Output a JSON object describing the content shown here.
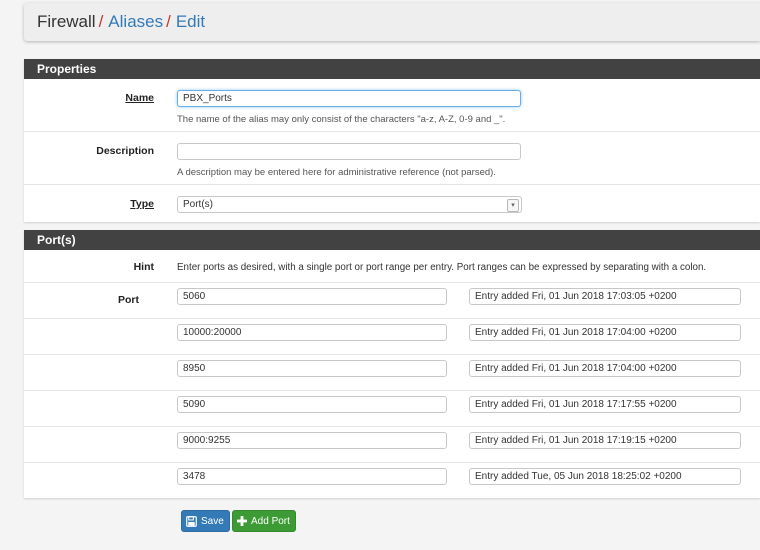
{
  "breadcrumb": {
    "first": "Firewall",
    "second": "Aliases",
    "third": "Edit",
    "separator": "/"
  },
  "properties": {
    "heading": "Properties",
    "name_label": "Name",
    "name_value": "PBX_Ports",
    "name_help": "The name of the alias may only consist of the characters \"a-z, A-Z, 0-9 and _\".",
    "description_label": "Description",
    "description_value": "",
    "description_help": "A description may be entered here for administrative reference (not parsed).",
    "type_label": "Type",
    "type_value": "Port(s)"
  },
  "ports": {
    "heading": "Port(s)",
    "hint_label": "Hint",
    "hint_text": "Enter ports as desired, with a single port or port range per entry. Port ranges can be expressed by separating with a colon.",
    "port_label": "Port",
    "entries": [
      {
        "port": "5060",
        "desc": "Entry added Fri, 01 Jun 2018 17:03:05 +0200"
      },
      {
        "port": "10000:20000",
        "desc": "Entry added Fri, 01 Jun 2018 17:04:00 +0200"
      },
      {
        "port": "8950",
        "desc": "Entry added Fri, 01 Jun 2018 17:04:00 +0200"
      },
      {
        "port": "5090",
        "desc": "Entry added Fri, 01 Jun 2018 17:17:55 +0200"
      },
      {
        "port": "9000:9255",
        "desc": "Entry added Fri, 01 Jun 2018 17:19:15 +0200"
      },
      {
        "port": "3478",
        "desc": "Entry added Tue, 05 Jun 2018 18:25:02 +0200"
      }
    ]
  },
  "buttons": {
    "save": "Save",
    "add_port": "Add Port"
  },
  "colors": {
    "heading_bg": "#424242",
    "save_btn": "#337ab7",
    "add_btn": "#3d9b35",
    "link": "#337ab7",
    "separator": "#c0392b"
  }
}
